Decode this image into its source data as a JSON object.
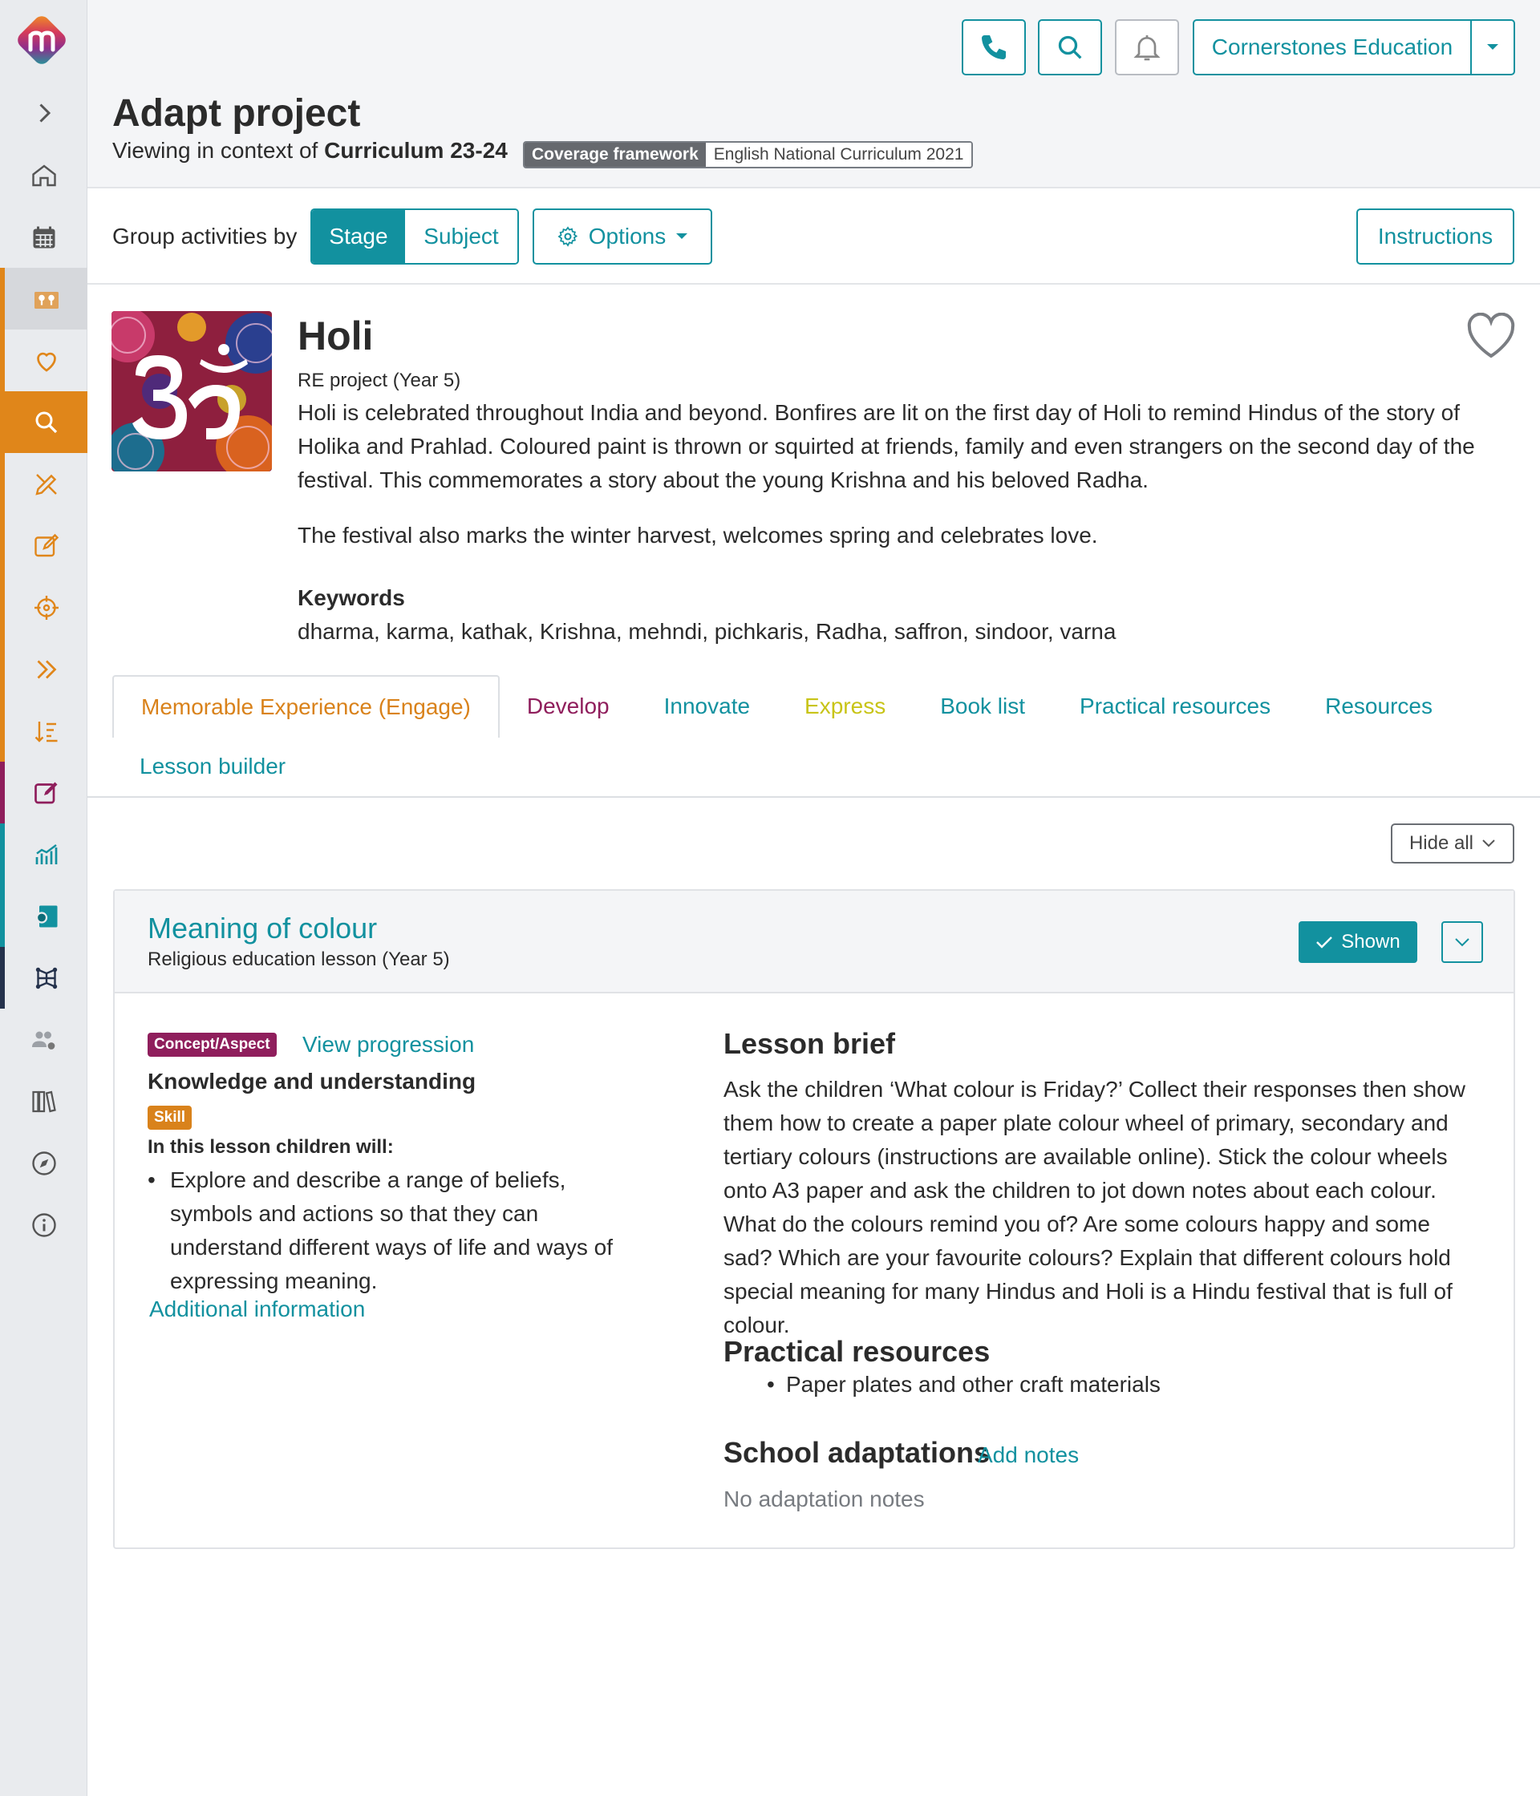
{
  "header": {
    "school_name": "Cornerstones Education",
    "page_title": "Adapt project",
    "context_prefix": "Viewing in context of",
    "context_value": "Curriculum 23-24",
    "framework_label": "Coverage framework",
    "framework_value": "English National Curriculum 2021"
  },
  "sidebar": {
    "icons": [
      "menu-chevron-icon",
      "home-icon",
      "calendar-icon",
      "map-icon",
      "heart-icon",
      "search-icon",
      "design-icon",
      "edit-icon",
      "target-icon",
      "double-chevron-icon",
      "sort-icon",
      "pencil-square-icon",
      "chart-icon",
      "certificate-icon",
      "network-icon",
      "people-settings-icon",
      "library-icon",
      "compass-icon",
      "info-icon"
    ],
    "colors": {
      "orange": "#e0861a",
      "purple": "#8f1e5c",
      "teal": "#12919f",
      "navy": "#25324c"
    }
  },
  "groupbar": {
    "label": "Group activities by",
    "stage": "Stage",
    "subject": "Subject",
    "options": "Options",
    "instructions": "Instructions"
  },
  "project": {
    "title": "Holi",
    "subtitle": "RE project (Year 5)",
    "description": "Holi is celebrated throughout India and beyond. Bonfires are lit on the first day of Holi to remind Hindus of the story of Holika and Prahlad. Coloured paint is thrown or squirted at friends, family and even strangers on the second day of the festival. This commemorates a story about the young Krishna and his beloved Radha.",
    "description2": "The festival also marks the winter harvest, welcomes spring and celebrates love.",
    "keywords_title": "Keywords",
    "keywords": "dharma, karma, kathak, Krishna, mehndi, pichkaris, Radha, saffron, sindoor, varna"
  },
  "tabs": [
    {
      "label": "Memorable Experience (Engage)",
      "color": "#d9821b"
    },
    {
      "label": "Develop",
      "color": "#8f1e5c"
    },
    {
      "label": "Innovate",
      "color": "#12919f"
    },
    {
      "label": "Express",
      "color": "#c8c417"
    },
    {
      "label": "Book list",
      "color": "#12919f"
    },
    {
      "label": "Practical resources",
      "color": "#12919f"
    },
    {
      "label": "Resources",
      "color": "#12919f"
    },
    {
      "label": "Lesson builder",
      "color": "#12919f"
    }
  ],
  "hide_all": "Hide all",
  "lesson": {
    "title": "Meaning of colour",
    "subtitle": "Religious education lesson (Year 5)",
    "shown": "Shown",
    "concept_badge": "Concept/Aspect",
    "view_progression": "View progression",
    "concept": "Knowledge and understanding",
    "skill_badge": "Skill",
    "will_title": "In this lesson children will:",
    "aims": [
      "Explore and describe a range of beliefs, symbols and actions so that they can understand different ways of life and ways of expressing meaning."
    ],
    "additional": "Additional information",
    "brief_title": "Lesson brief",
    "brief": "Ask the children ‘What colour is Friday?’ Collect their responses then show them how to create a paper plate colour wheel of primary, secondary and tertiary colours (instructions are available online). Stick the colour wheels onto A3 paper and ask the children to jot down notes about each colour. What do the colours remind you of? Are some colours happy and some sad? Which are your favourite colours? Explain that different colours hold special meaning for many Hindus and Holi is a Hindu festival that is full of colour.",
    "practical_title": "Practical resources",
    "practical": [
      "Paper plates and other craft materials"
    ],
    "adaptations_title": "School adaptations",
    "add_notes": "Add notes",
    "no_notes": "No adaptation notes"
  }
}
